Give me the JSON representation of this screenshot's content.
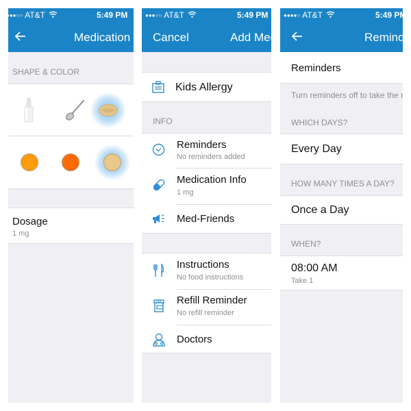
{
  "status_bar": {
    "carrier": "AT&T",
    "time": "5:49 PM",
    "signal_dots_panel1": "●●●○○",
    "signal_dots_panel2": "●●●○○",
    "signal_dots_panel3": "●●●●○"
  },
  "colors": {
    "header_blue": "#1b84c7",
    "icon_blue": "#2f8fd6",
    "group_bg": "#efeff4",
    "orange": "#ff9a0a",
    "dark_orange": "#ff6a05",
    "tan": "#e8c98a"
  },
  "panel1": {
    "nav_title": "Medication Info",
    "section_label": "SHAPE & COLOR",
    "shapes": [
      {
        "name": "dropper-bottle",
        "selected": false
      },
      {
        "name": "spoon",
        "selected": false
      },
      {
        "name": "oval-pill",
        "selected": true
      }
    ],
    "colors": [
      {
        "name": "orange",
        "hex": "#ff9a0a",
        "selected": false
      },
      {
        "name": "dark-orange",
        "hex": "#ff6a05",
        "selected": false
      },
      {
        "name": "tan",
        "hex": "#e8c98a",
        "selected": true
      }
    ],
    "dosage_label": "Dosage",
    "dosage_value": "1 mg"
  },
  "panel2": {
    "cancel_label": "Cancel",
    "nav_title": "Add Medication",
    "medication_name": "Kids Allergy",
    "info_label": "INFO",
    "info_items": [
      {
        "title": "Reminders",
        "subtitle": "No reminders added",
        "icon": "clock-icon"
      },
      {
        "title": "Medication Info",
        "subtitle": "1 mg",
        "icon": "pill-icon"
      },
      {
        "title": "Med-Friends",
        "subtitle": "",
        "icon": "megaphone-icon"
      }
    ],
    "more_items": [
      {
        "title": "Instructions",
        "subtitle": "No food instructions",
        "icon": "fork-knife-icon"
      },
      {
        "title": "Refill Reminder",
        "subtitle": "No refill reminder",
        "icon": "pill-bottle-icon"
      },
      {
        "title": "Doctors",
        "subtitle": "",
        "icon": "doctor-icon"
      }
    ]
  },
  "panel3": {
    "nav_title": "Reminders",
    "reminders_toggle_label": "Reminders",
    "note": "Turn reminders off to take the medication as needed",
    "which_days_label": "WHICH DAYS?",
    "which_days_value": "Every Day",
    "times_label": "HOW MANY TIMES A DAY?",
    "times_value": "Once a Day",
    "when_label": "WHEN?",
    "when_time": "08:00 AM",
    "when_dose": "Take 1"
  }
}
